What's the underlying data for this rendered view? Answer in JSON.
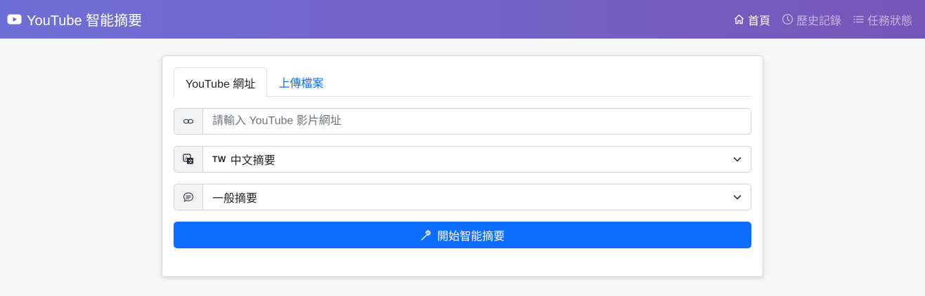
{
  "navbar": {
    "brand": "YouTube 智能摘要",
    "links": [
      {
        "label": "首頁",
        "icon": "home-icon",
        "active": true
      },
      {
        "label": "歷史記錄",
        "icon": "clock-icon",
        "active": false
      },
      {
        "label": "任務狀態",
        "icon": "list-icon",
        "active": false
      }
    ]
  },
  "card": {
    "tabs": [
      {
        "label": "YouTube 網址",
        "active": true
      },
      {
        "label": "上傳檔案",
        "active": false
      }
    ],
    "url_input": {
      "value": "",
      "placeholder": "請輸入 YouTube 影片網址",
      "icon": "link-icon"
    },
    "language_select": {
      "flag": "TW",
      "value": "中文摘要",
      "icon": "translate-icon"
    },
    "summary_select": {
      "value": "一般摘要",
      "icon": "chat-icon"
    },
    "submit_label": "開始智能摘要"
  },
  "colors": {
    "navbar_gradient_start": "#6e6fd6",
    "navbar_gradient_end": "#7656b8",
    "primary": "#0d6efd",
    "background": "#f5f6f8"
  }
}
